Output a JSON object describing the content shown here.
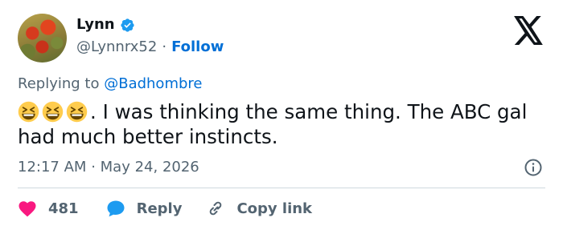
{
  "user": {
    "name": "Lynn",
    "handle": "@Lynnrx52",
    "separator": "·",
    "follow_label": "Follow"
  },
  "reply_to": {
    "prefix": "Replying to",
    "mention": "@Badhombre"
  },
  "tweet": {
    "emojis": [
      "grinning-squinting-face",
      "grinning-squinting-face",
      "grinning-squinting-face"
    ],
    "text": ". I was thinking the same thing. The ABC gal had much better instincts."
  },
  "meta": {
    "time": "12:17 AM",
    "separator": "·",
    "date": "May 24, 2026"
  },
  "actions": {
    "like_count": "481",
    "reply_label": "Reply",
    "copy_label": "Copy link"
  },
  "colors": {
    "accent": "#006fd6",
    "like": "#f91880",
    "reply_bubble": "#1d9bf0",
    "muted": "#536471",
    "divider": "#cfd9de"
  }
}
